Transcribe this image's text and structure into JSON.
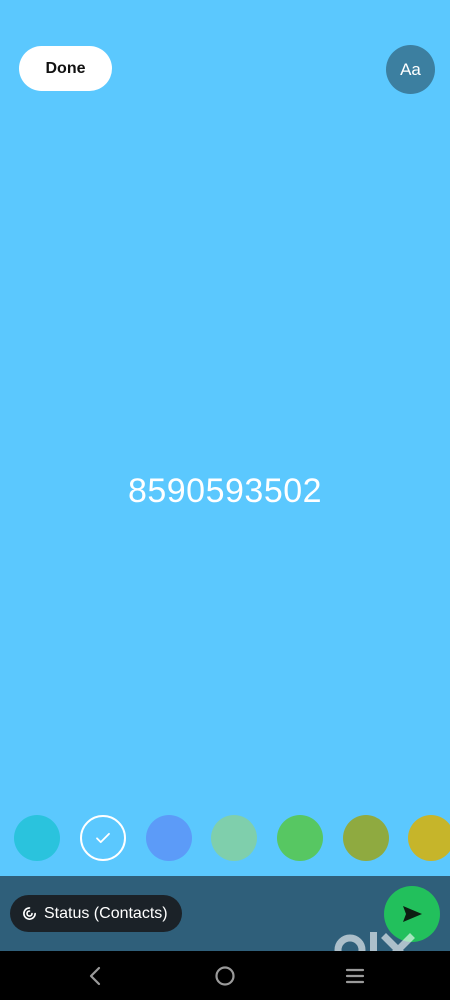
{
  "header": {
    "done_label": "Done",
    "font_toggle_label": "Aa"
  },
  "status": {
    "text": "8590593502"
  },
  "palette": {
    "selected_index": 1,
    "swatches": [
      {
        "color": "#2ac3dd"
      },
      {
        "color": "#5bc8fe"
      },
      {
        "color": "#5c9bf8"
      },
      {
        "color": "#7fcfac"
      },
      {
        "color": "#57c762"
      },
      {
        "color": "#8faa40"
      },
      {
        "color": "#c6b52a"
      }
    ]
  },
  "footer": {
    "audience_label": "Status (Contacts)",
    "audience_icon": "status-ring-icon",
    "send_icon": "send-arrow-icon"
  },
  "navigation": {
    "back_icon": "back-chevron-icon",
    "home_icon": "home-circle-icon",
    "recents_icon": "recents-lines-icon"
  },
  "watermark": {
    "brand": "OLX"
  },
  "colors": {
    "background": "#5bc8fe",
    "bottom_bar": "#2f5f7a",
    "send_button": "#22c05c",
    "font_button": "#3c7fa0"
  }
}
